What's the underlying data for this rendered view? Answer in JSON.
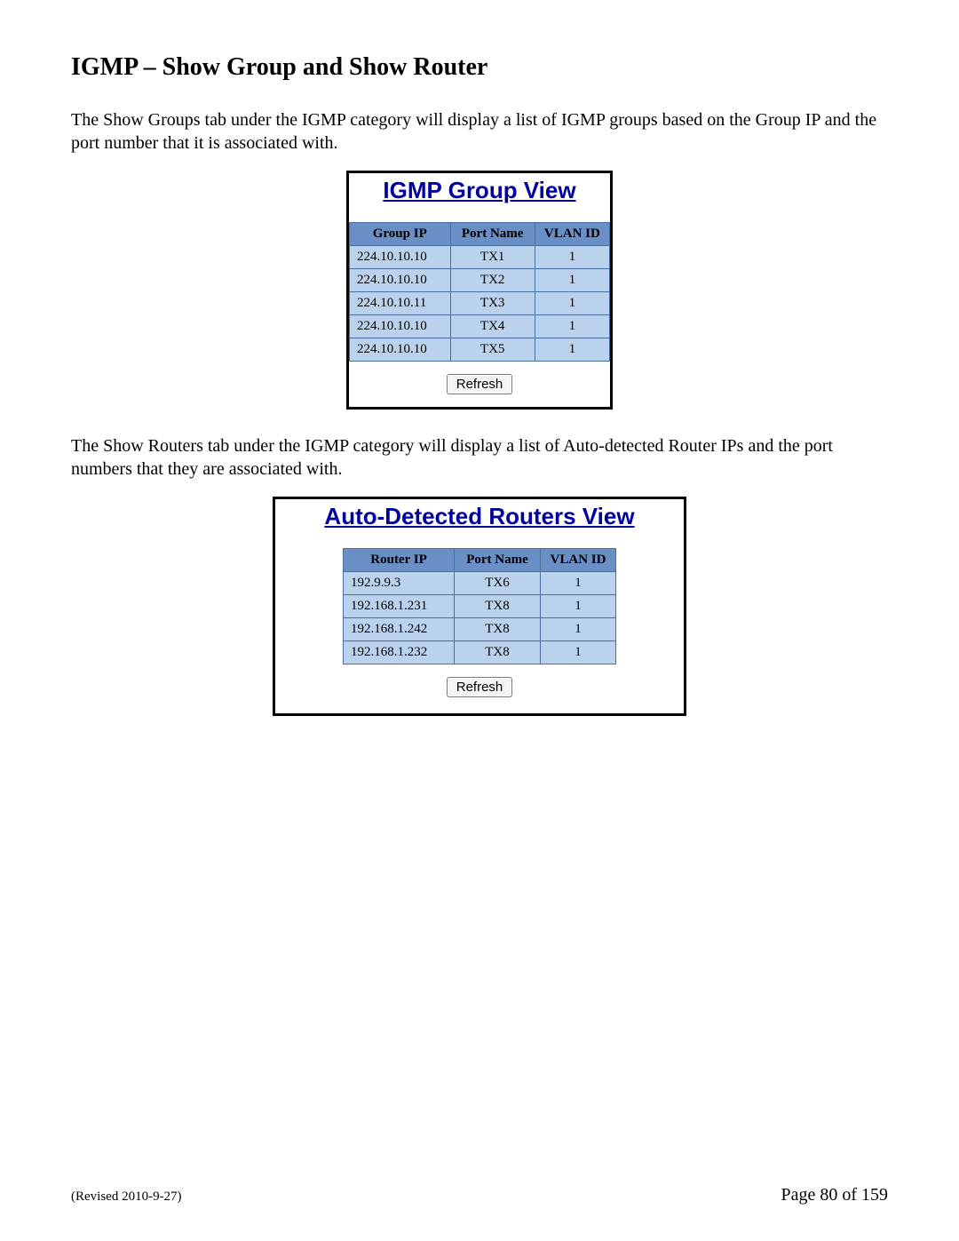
{
  "section_title": "IGMP – Show Group and Show Router",
  "intro_para_1": "The Show Groups tab under the IGMP category will display a list of IGMP groups based on the Group IP and the port number that it is associated with.",
  "intro_para_2": "The Show Routers tab under the IGMP category will display a list of Auto-detected Router IPs and the port numbers that they are associated with.",
  "group_view": {
    "title": "IGMP Group View",
    "headers": {
      "ip": "Group IP",
      "port": "Port Name",
      "vlan": "VLAN ID"
    },
    "rows": [
      {
        "ip": "224.10.10.10",
        "port": "TX1",
        "vlan": "1"
      },
      {
        "ip": "224.10.10.10",
        "port": "TX2",
        "vlan": "1"
      },
      {
        "ip": "224.10.10.11",
        "port": "TX3",
        "vlan": "1"
      },
      {
        "ip": "224.10.10.10",
        "port": "TX4",
        "vlan": "1"
      },
      {
        "ip": "224.10.10.10",
        "port": "TX5",
        "vlan": "1"
      }
    ],
    "refresh_label": "Refresh"
  },
  "router_view": {
    "title": "Auto-Detected Routers View",
    "headers": {
      "ip": "Router IP",
      "port": "Port Name",
      "vlan": "VLAN ID"
    },
    "rows": [
      {
        "ip": "192.9.9.3",
        "port": "TX6",
        "vlan": "1"
      },
      {
        "ip": "192.168.1.231",
        "port": "TX8",
        "vlan": "1"
      },
      {
        "ip": "192.168.1.242",
        "port": "TX8",
        "vlan": "1"
      },
      {
        "ip": "192.168.1.232",
        "port": "TX8",
        "vlan": "1"
      }
    ],
    "refresh_label": "Refresh"
  },
  "footer": {
    "revised": "(Revised 2010-9-27)",
    "page": "Page 80 of 159"
  }
}
